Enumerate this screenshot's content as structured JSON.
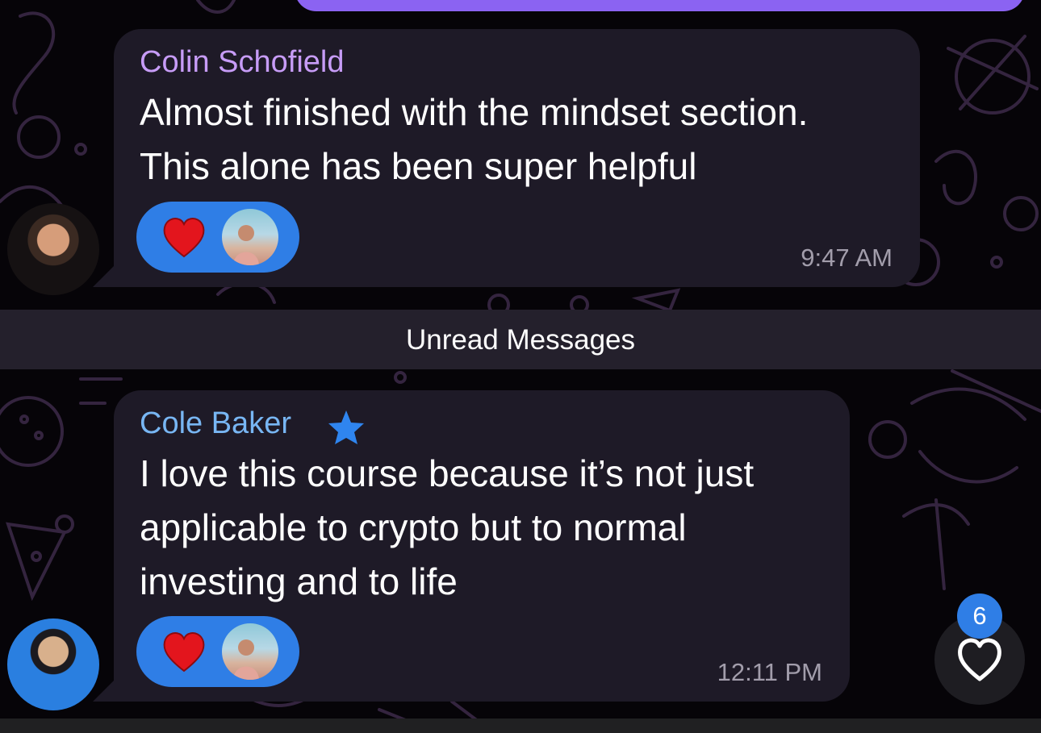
{
  "colors": {
    "background": "#060408",
    "bubble": "#1e1a27",
    "sender_purple": "#c79cf7",
    "sender_blue": "#78b6f3",
    "reaction_blue": "#2f7ee6",
    "own_bubble": "#8b63f2",
    "time_gray": "#a29dab"
  },
  "messages": [
    {
      "sender": "Colin Schofield",
      "text": "Almost finished with the mindset section.\nThis alone has been super helpful",
      "time": "9:47 AM",
      "reaction_icon": "red-heart-icon"
    },
    {
      "sender": "Cole Baker",
      "sender_badge_icon": "star-icon",
      "text": "I love this course because it’s not just\napplicable to crypto but to normal\ninvesting and to life",
      "time": "12:11 PM",
      "reaction_icon": "red-heart-icon"
    }
  ],
  "divider": {
    "label": "Unread Messages"
  },
  "unread_reactions": {
    "count": "6",
    "icon": "heart-outline-icon"
  }
}
